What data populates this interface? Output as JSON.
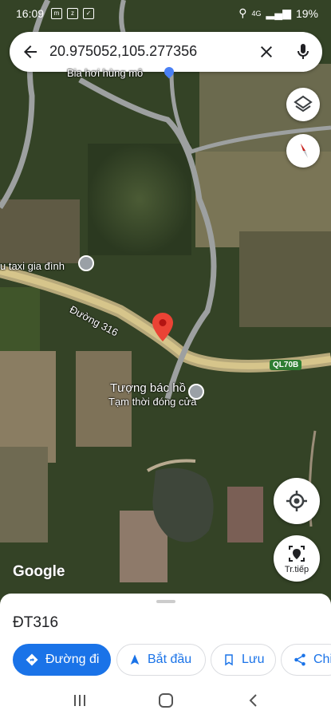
{
  "status_bar": {
    "time": "16:09",
    "battery": "19%",
    "network": "4G"
  },
  "search": {
    "query": "20.975052,105.277356"
  },
  "map_labels": {
    "top_place": "Bia hơi hùng mô",
    "taxi": "u taxi gia đình",
    "road": "Đường 316",
    "route_badge": "QL70B",
    "monument": "Tượng bác hồ",
    "monument_status": "Tạm thời đóng cửa"
  },
  "watermark": "Google",
  "live_view_label": "Tr.tiếp",
  "sheet": {
    "place_name": "ĐT316",
    "actions": {
      "directions": "Đường đi",
      "start": "Bắt đầu",
      "save": "Lưu",
      "share": "Chi"
    }
  },
  "colors": {
    "accent": "#1a73e8",
    "pin": "#ea4335"
  }
}
